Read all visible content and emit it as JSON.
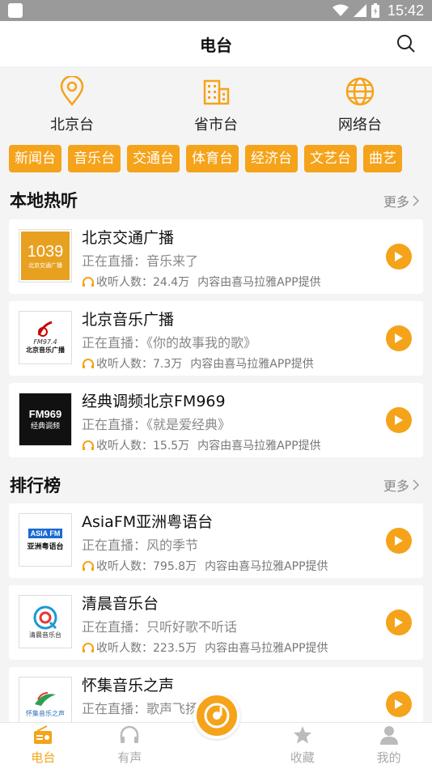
{
  "status_bar": {
    "time": "15:42"
  },
  "header": {
    "title": "电台"
  },
  "categories": [
    {
      "label": "北京台",
      "icon": "location-pin-icon"
    },
    {
      "label": "省市台",
      "icon": "building-icon"
    },
    {
      "label": "网络台",
      "icon": "globe-icon"
    }
  ],
  "tags": [
    "新闻台",
    "音乐台",
    "交通台",
    "体育台",
    "经济台",
    "文艺台",
    "曲艺"
  ],
  "local_section": {
    "title": "本地热听",
    "more": "更多"
  },
  "ranking_section": {
    "title": "排行榜",
    "more": "更多"
  },
  "local_items": [
    {
      "name": "北京交通广播",
      "live": "正在直播：音乐来了",
      "listeners": "收听人数：24.4万",
      "source": "内容由喜马拉雅APP提供",
      "logo_text": "1039",
      "logo_sub": "北京交通广播"
    },
    {
      "name": "北京音乐广播",
      "live": "正在直播：《你的故事我的歌》",
      "listeners": "收听人数：7.3万",
      "source": "内容由喜马拉雅APP提供",
      "logo_text": "FM97.4",
      "logo_sub": "北京音乐广播"
    },
    {
      "name": "经典调频北京FM969",
      "live": "正在直播：《就是爱经典》",
      "listeners": "收听人数：15.5万",
      "source": "内容由喜马拉雅APP提供",
      "logo_text": "FM969",
      "logo_sub": "经典调频"
    }
  ],
  "ranking_items": [
    {
      "name": "AsiaFM亚洲粤语台",
      "live": "正在直播：风的季节",
      "listeners": "收听人数：795.8万",
      "source": "内容由喜马拉雅APP提供",
      "logo_text": "ASIA FM",
      "logo_sub": "亚洲粤语台"
    },
    {
      "name": "清晨音乐台",
      "live": "正在直播：只听好歌不听话",
      "listeners": "收听人数：223.5万",
      "source": "内容由喜马拉雅APP提供",
      "logo_text": "清晨音乐台",
      "logo_sub": ""
    },
    {
      "name": "怀集音乐之声",
      "live": "正在直播：歌声飞扬",
      "listeners": "",
      "source": "",
      "logo_text": "怀集音乐之声",
      "logo_sub": ""
    }
  ],
  "tabbar": [
    {
      "label": "电台",
      "icon": "radio-icon",
      "active": true
    },
    {
      "label": "有声",
      "icon": "headphones-icon",
      "active": false
    },
    {
      "label": "收藏",
      "icon": "star-icon",
      "active": false
    },
    {
      "label": "我的",
      "icon": "person-icon",
      "active": false
    }
  ],
  "colors": {
    "accent": "#f5a31a",
    "background": "#f4f4f4"
  }
}
